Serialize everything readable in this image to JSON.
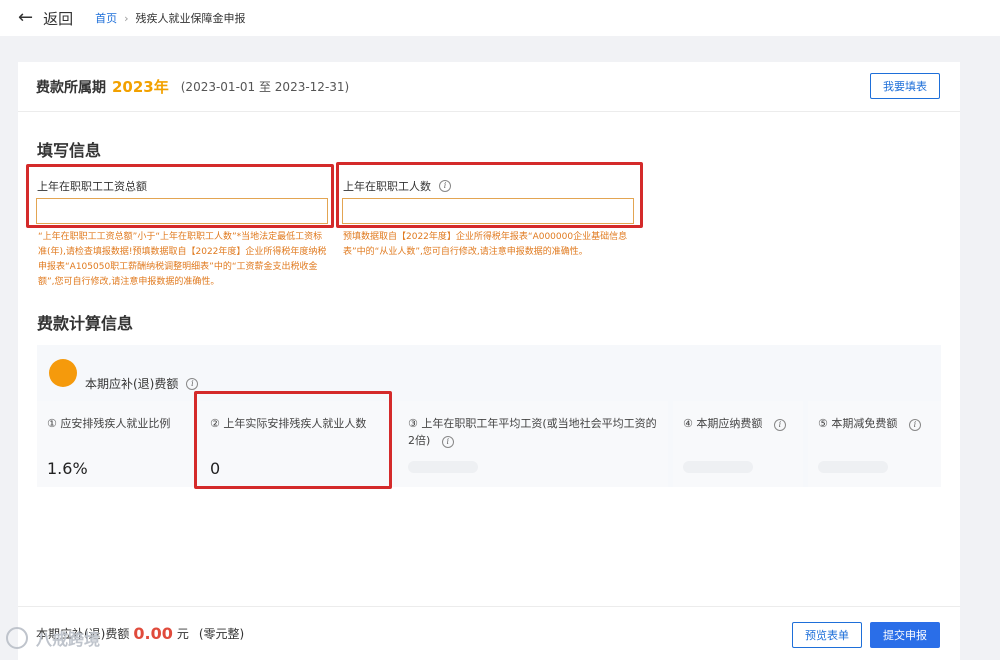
{
  "nav": {
    "back_label": "返回",
    "breadcrumb_home": "首页",
    "breadcrumb_sep": "›",
    "breadcrumb_current": "残疾人就业保障金申报"
  },
  "period": {
    "label": "费款所属期",
    "year": "2023年",
    "range": "(2023-01-01 至 2023-12-31)",
    "fill_button": "我要填表"
  },
  "fill_section": {
    "title": "填写信息",
    "wage_total": {
      "label": "上年在职职工工资总额",
      "value": "",
      "hint": "“上年在职职工工资总额”小于“上年在职职工人数”*当地法定最低工资标准(年),请检查填报数据!预填数据取自【2022年度】企业所得税年度纳税申报表“A105050职工薪酬纳税调整明细表”中的“工资薪金支出税收金额”,您可自行修改,请注意申报数据的准确性。"
    },
    "staff_count": {
      "label": "上年在职职工人数",
      "value": "",
      "hint": "预填数据取自【2022年度】企业所得税年报表“A000000企业基础信息表”中的“从业人数”,您可自行修改,请注意申报数据的准确性。"
    }
  },
  "calc_section": {
    "title": "费款计算信息",
    "head_label": "本期应补(退)费额",
    "metrics": [
      {
        "label": "① 应安排残疾人就业比例",
        "value": "1.6%"
      },
      {
        "label": "② 上年实际安排残疾人就业人数",
        "value": "0"
      },
      {
        "label": "③ 上年在职职工年平均工资(或当地社会平均工资的2倍)",
        "value": ""
      },
      {
        "label": "④ 本期应纳费额",
        "value": ""
      },
      {
        "label": "⑤ 本期减免费额",
        "value": ""
      }
    ]
  },
  "footer": {
    "label": "本期应补(退)费额",
    "amount": "0.00",
    "unit": "元",
    "words": "(零元整)",
    "preview_button": "预览表单",
    "submit_button": "提交申报"
  },
  "watermark": {
    "text": "八戒跨境"
  },
  "colors": {
    "accent_blue": "#1e6fd9",
    "year_orange": "#f2a100",
    "hint_orange": "#e07a1f",
    "amount_red": "#e04b3c",
    "highlight_red": "#d42a2a"
  }
}
